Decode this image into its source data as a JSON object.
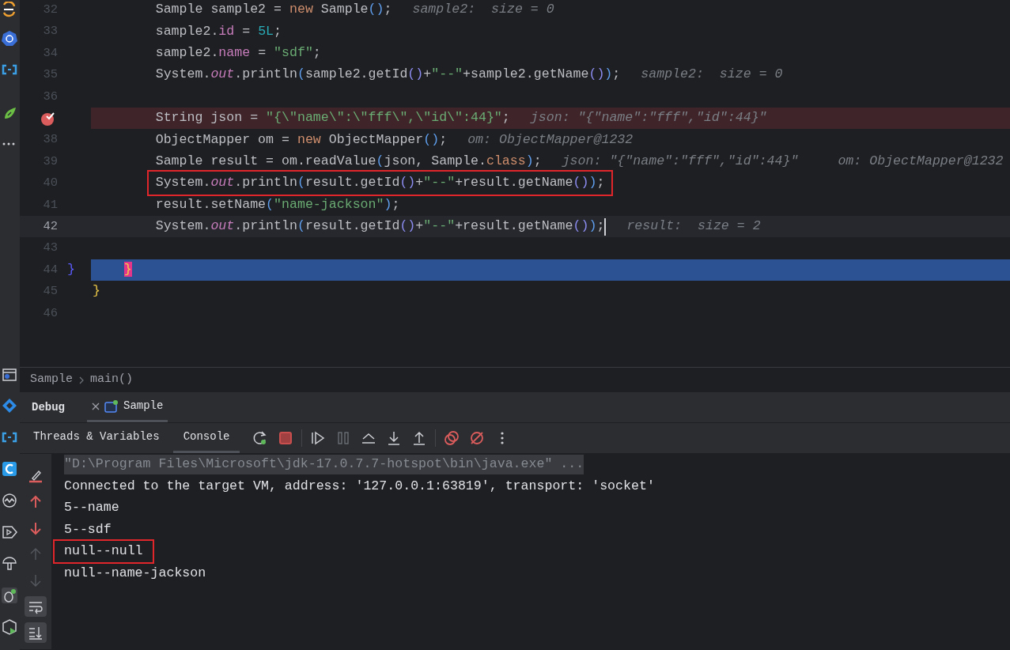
{
  "editor": {
    "lines": [
      {
        "number": "32",
        "kind": "normal",
        "boxed": false,
        "tokens": [
          {
            "text": "        Sample sample2 = ",
            "kind": "plain"
          },
          {
            "text": "new",
            "kind": "kw"
          },
          {
            "text": " Sample",
            "kind": "plain"
          },
          {
            "text": "()",
            "kind": "p1"
          },
          {
            "text": ";",
            "kind": "plain"
          }
        ],
        "hints": [
          "sample2:  size = 0"
        ]
      },
      {
        "number": "33",
        "kind": "normal",
        "boxed": false,
        "tokens": [
          {
            "text": "        sample2.",
            "kind": "plain"
          },
          {
            "text": "id",
            "kind": "field"
          },
          {
            "text": " = ",
            "kind": "plain"
          },
          {
            "text": "5L",
            "kind": "num"
          },
          {
            "text": ";",
            "kind": "plain"
          }
        ]
      },
      {
        "number": "34",
        "kind": "normal",
        "boxed": false,
        "tokens": [
          {
            "text": "        sample2.",
            "kind": "plain"
          },
          {
            "text": "name",
            "kind": "field"
          },
          {
            "text": " = ",
            "kind": "plain"
          },
          {
            "text": "\"sdf\"",
            "kind": "str"
          },
          {
            "text": ";",
            "kind": "plain"
          }
        ]
      },
      {
        "number": "35",
        "kind": "normal",
        "boxed": false,
        "tokens": [
          {
            "text": "        System.",
            "kind": "plain"
          },
          {
            "text": "out",
            "kind": "static"
          },
          {
            "text": ".println",
            "kind": "plain"
          },
          {
            "text": "(",
            "kind": "p1"
          },
          {
            "text": "sample2.getId",
            "kind": "plain"
          },
          {
            "text": "()",
            "kind": "p2"
          },
          {
            "text": "+",
            "kind": "plain"
          },
          {
            "text": "\"--\"",
            "kind": "str"
          },
          {
            "text": "+sample2.getName",
            "kind": "plain"
          },
          {
            "text": "()",
            "kind": "p2"
          },
          {
            "text": ")",
            "kind": "p1"
          },
          {
            "text": ";",
            "kind": "plain"
          }
        ],
        "hints": [
          "sample2:  size = 0"
        ]
      },
      {
        "number": "36",
        "kind": "normal",
        "boxed": false
      },
      {
        "kind": "breakpoint",
        "boxed": false,
        "tokens": [
          {
            "text": "        String json = ",
            "kind": "plain"
          },
          {
            "text": "\"{\\\"name\\\":\\\"fff\\\",\\\"id\\\":44}\"",
            "kind": "str"
          },
          {
            "text": ";",
            "kind": "plain"
          }
        ],
        "hints": [
          "json: \"{\"name\":\"fff\",\"id\":44}\""
        ]
      },
      {
        "number": "38",
        "kind": "normal",
        "boxed": false,
        "tokens": [
          {
            "text": "        ObjectMapper om = ",
            "kind": "plain"
          },
          {
            "text": "new",
            "kind": "kw"
          },
          {
            "text": " ObjectMapper",
            "kind": "plain"
          },
          {
            "text": "()",
            "kind": "p1"
          },
          {
            "text": ";",
            "kind": "plain"
          }
        ],
        "hints": [
          "om: ObjectMapper@1232"
        ]
      },
      {
        "number": "39",
        "kind": "normal",
        "boxed": false,
        "tokens": [
          {
            "text": "        Sample result = om.readValue",
            "kind": "plain"
          },
          {
            "text": "(",
            "kind": "p1"
          },
          {
            "text": "json, Sample.",
            "kind": "plain"
          },
          {
            "text": "class",
            "kind": "kw"
          },
          {
            "text": ")",
            "kind": "p1"
          },
          {
            "text": ";",
            "kind": "plain"
          }
        ],
        "hints": [
          "json: \"{\"name\":\"fff\",\"id\":44}\"",
          "om: ObjectMapper@1232"
        ]
      },
      {
        "number": "40",
        "kind": "normal",
        "boxed": true,
        "tokens": [
          {
            "text": "        System.",
            "kind": "plain"
          },
          {
            "text": "out",
            "kind": "static"
          },
          {
            "text": ".println",
            "kind": "plain"
          },
          {
            "text": "(",
            "kind": "p1"
          },
          {
            "text": "result.getId",
            "kind": "plain"
          },
          {
            "text": "()",
            "kind": "p2"
          },
          {
            "text": "+",
            "kind": "plain"
          },
          {
            "text": "\"--\"",
            "kind": "str"
          },
          {
            "text": "+result.getName",
            "kind": "plain"
          },
          {
            "text": "()",
            "kind": "p2"
          },
          {
            "text": ")",
            "kind": "p1"
          },
          {
            "text": ";",
            "kind": "plain"
          }
        ]
      },
      {
        "number": "41",
        "kind": "normal",
        "boxed": false,
        "tokens": [
          {
            "text": "        result.setName",
            "kind": "plain"
          },
          {
            "text": "(",
            "kind": "p1"
          },
          {
            "text": "\"name-jackson\"",
            "kind": "str"
          },
          {
            "text": ")",
            "kind": "p1"
          },
          {
            "text": ";",
            "kind": "plain"
          }
        ]
      },
      {
        "number": "42",
        "kind": "current",
        "boxed": false,
        "tokens": [
          {
            "text": "        System.",
            "kind": "plain"
          },
          {
            "text": "out",
            "kind": "static"
          },
          {
            "text": ".println",
            "kind": "plain"
          },
          {
            "text": "(",
            "kind": "p1"
          },
          {
            "text": "result.getId",
            "kind": "plain"
          },
          {
            "text": "()",
            "kind": "p2"
          },
          {
            "text": "+",
            "kind": "plain"
          },
          {
            "text": "\"--\"",
            "kind": "str"
          },
          {
            "text": "+result.getName",
            "kind": "plain"
          },
          {
            "text": "()",
            "kind": "p2"
          },
          {
            "text": ")",
            "kind": "p1"
          },
          {
            "text": ";",
            "kind": "plain"
          }
        ],
        "hints": [
          "result:  size = 2"
        ]
      },
      {
        "number": "43",
        "kind": "normal",
        "boxed": false
      },
      {
        "number": "44",
        "kind": "execution",
        "boxed": false,
        "gutter_text": "}",
        "tokens": [
          {
            "text": "    }",
            "kind": "brace_match"
          }
        ]
      },
      {
        "number": "45",
        "kind": "normal",
        "boxed": false,
        "tokens": [
          {
            "text": "}",
            "kind": "brace"
          }
        ]
      },
      {
        "number": "46",
        "kind": "normal",
        "boxed": false
      }
    ]
  },
  "breadcrumb": [
    "Sample",
    "main()"
  ],
  "debug": {
    "title": "Debug",
    "session": "Sample",
    "tabs": [
      {
        "label": "Threads & Variables",
        "selected": false
      },
      {
        "label": "Console",
        "selected": true
      }
    ],
    "console": [
      {
        "text": "\"D:\\Program Files\\Microsoft\\jdk-17.0.7.7-hotspot\\bin\\java.exe\" ...",
        "kind": "command",
        "boxed": false
      },
      {
        "text": "Connected to the target VM, address: '127.0.0.1:63819', transport: 'socket'",
        "kind": "output",
        "boxed": false
      },
      {
        "text": "5--name",
        "kind": "output",
        "boxed": false
      },
      {
        "text": "5--sdf",
        "kind": "output",
        "boxed": false
      },
      {
        "text": "null--null",
        "kind": "output",
        "boxed": true
      },
      {
        "text": "null--name-jackson",
        "kind": "output",
        "boxed": false
      }
    ]
  }
}
